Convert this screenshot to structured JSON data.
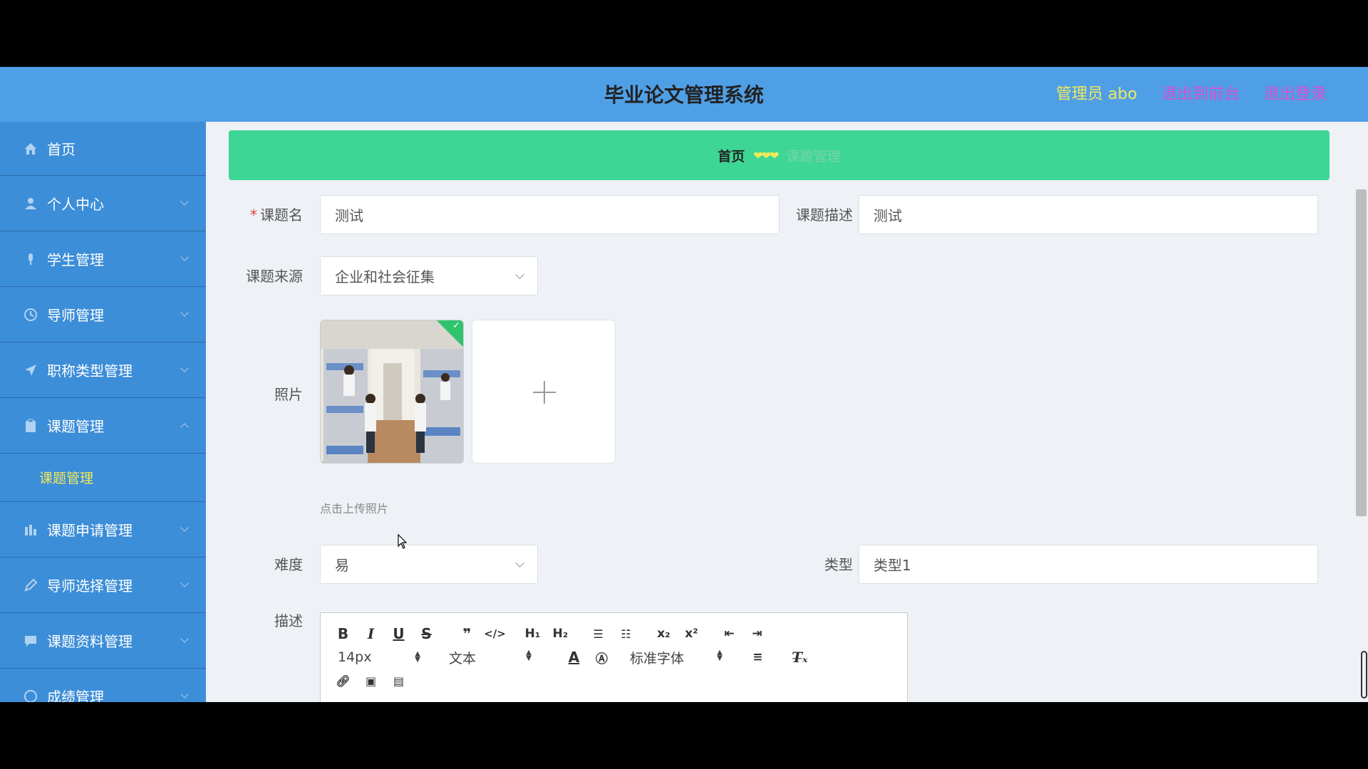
{
  "header": {
    "title": "毕业论文管理系统",
    "user": "管理员 abo",
    "to_front": "退出到前台",
    "logout": "退出登录"
  },
  "sidebar": {
    "items": [
      {
        "label": "首页",
        "icon": "home-icon"
      },
      {
        "label": "个人中心",
        "icon": "user-icon"
      },
      {
        "label": "学生管理",
        "icon": "mic-icon"
      },
      {
        "label": "导师管理",
        "icon": "clock-icon"
      },
      {
        "label": "职称类型管理",
        "icon": "send-icon"
      },
      {
        "label": "课题管理",
        "icon": "clipboard-icon"
      },
      {
        "label": "课题申请管理",
        "icon": "chart-icon"
      },
      {
        "label": "导师选择管理",
        "icon": "pen-icon"
      },
      {
        "label": "课题资料管理",
        "icon": "chat-icon"
      },
      {
        "label": "成绩管理",
        "icon": "circle-icon"
      }
    ],
    "sub_item": "课题管理"
  },
  "breadcrumb": {
    "home": "首页",
    "current": "课题管理"
  },
  "form": {
    "title_label": "课题名",
    "title_value": "测试",
    "desc_label": "课题描述",
    "desc_value": "测试",
    "source_label": "课题来源",
    "source_value": "企业和社会征集",
    "photo_label": "照片",
    "upload_hint": "点击上传照片",
    "difficulty_label": "难度",
    "difficulty_value": "易",
    "type_label": "类型",
    "type_value": "类型1",
    "description_label": "描述"
  },
  "editor": {
    "font_size": "14px",
    "text_style": "文本",
    "font_family": "标准字体"
  },
  "colors": {
    "header": "#4f9fe6",
    "sidebar": "#3d8ed8",
    "breadcrumb": "#3ed695",
    "highlight": "#f2e85a",
    "link": "#d84fd0"
  }
}
